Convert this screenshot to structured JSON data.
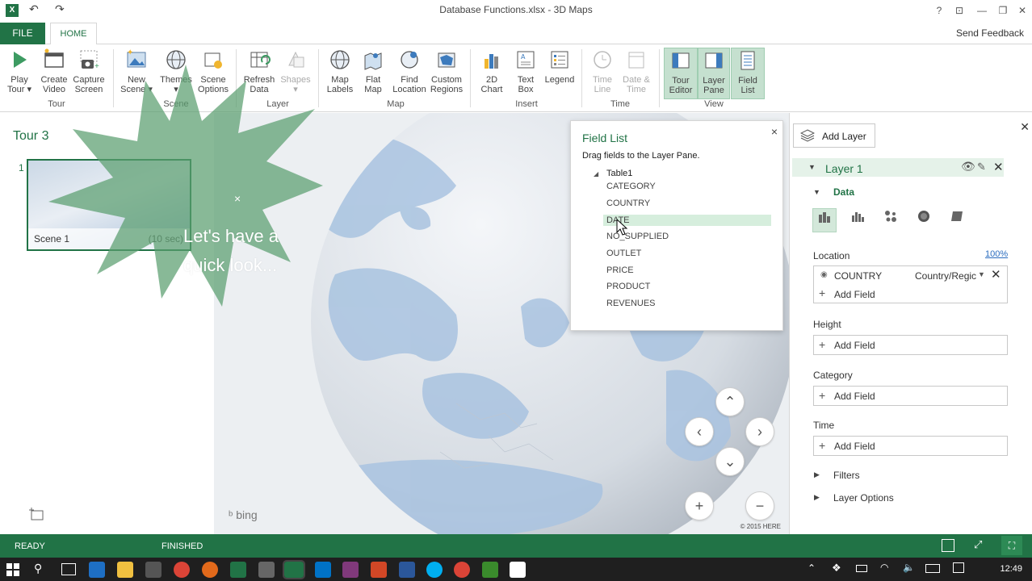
{
  "window": {
    "title": "Database Functions.xlsx - 3D Maps",
    "help": "?",
    "controls": [
      "restore-down",
      "minimize",
      "maximize",
      "close"
    ]
  },
  "ribbon_tabs": {
    "file": "FILE",
    "home": "HOME",
    "send_feedback": "Send Feedback"
  },
  "ribbon": {
    "tour": {
      "group": "Tour",
      "play_tour": [
        "Play",
        "Tour"
      ],
      "create_video": [
        "Create",
        "Video"
      ],
      "capture_screen": [
        "Capture",
        "Screen"
      ]
    },
    "scene": {
      "group": "Scene",
      "new_scene": [
        "New",
        "Scene"
      ],
      "themes": [
        "Themes",
        ""
      ],
      "scene_options": [
        "Scene",
        "Options"
      ]
    },
    "layer": {
      "group": "Layer",
      "refresh_data": [
        "Refresh",
        "Data"
      ],
      "shapes": [
        "Shapes",
        ""
      ]
    },
    "map": {
      "group": "Map",
      "map_labels": [
        "Map",
        "Labels"
      ],
      "flat_map": [
        "Flat",
        "Map"
      ],
      "find_location": [
        "Find",
        "Location"
      ],
      "custom_regions": [
        "Custom",
        "Regions"
      ]
    },
    "insert": {
      "group": "Insert",
      "chart_2d": [
        "2D",
        "Chart"
      ],
      "text_box": [
        "Text",
        "Box"
      ],
      "legend": [
        "Legend",
        ""
      ]
    },
    "time": {
      "group": "Time",
      "time_line": [
        "Time",
        "Line"
      ],
      "date_time": [
        "Date &",
        "Time"
      ]
    },
    "view": {
      "group": "View",
      "tour_editor": [
        "Tour",
        "Editor"
      ],
      "layer_pane": [
        "Layer",
        "Pane"
      ],
      "field_list": [
        "Field",
        "List"
      ]
    }
  },
  "tour_pane": {
    "title": "Tour 3",
    "scene_number": "1",
    "scene_label": "Scene 1",
    "scene_duration": "(10 sec)"
  },
  "callout": {
    "line1": "Let's have a",
    "line2": "quick look...",
    "close": "×"
  },
  "field_list": {
    "title": "Field List",
    "hint": "Drag fields to the Layer Pane.",
    "table": "Table1",
    "fields": [
      "CATEGORY",
      "COUNTRY",
      "DATE",
      "NO_SUPPLIED",
      "OUTLET",
      "PRICE",
      "PRODUCT",
      "REVENUES"
    ],
    "close": "×"
  },
  "map": {
    "bing": "bing",
    "copyright": "© 2015 HERE"
  },
  "layer_pane": {
    "add_layer": "Add Layer",
    "layer_name": "Layer 1",
    "data_section": "Data",
    "location": {
      "label": "Location",
      "percent": "100%",
      "field": "COUNTRY",
      "type": "Country/Regic",
      "add_field": "Add Field"
    },
    "height": {
      "label": "Height",
      "add_field": "Add Field"
    },
    "category": {
      "label": "Category",
      "add_field": "Add Field"
    },
    "time": {
      "label": "Time",
      "add_field": "Add Field"
    },
    "filters": "Filters",
    "layer_options": "Layer Options"
  },
  "status": {
    "ready": "READY",
    "finished": "FINISHED"
  },
  "taskbar": {
    "clock": "12:49"
  },
  "colors": {
    "accent": "#217346",
    "highlight": "#d6eedd",
    "ocean": "#a9c3e0",
    "land": "#f2f3f5"
  }
}
